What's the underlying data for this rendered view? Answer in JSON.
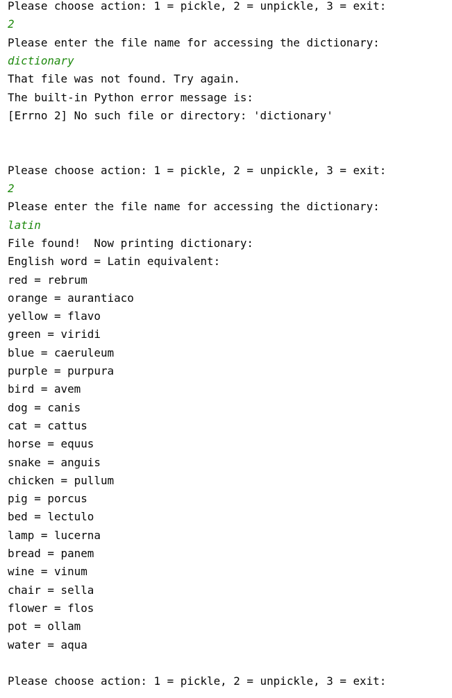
{
  "console": {
    "lines": [
      {
        "text": "Please choose action: 1 = pickle, 2 = unpickle, 3 = exit:",
        "kind": "output"
      },
      {
        "text": "2",
        "kind": "input"
      },
      {
        "text": "Please enter the file name for accessing the dictionary:",
        "kind": "output"
      },
      {
        "text": "dictionary",
        "kind": "input"
      },
      {
        "text": "That file was not found. Try again.",
        "kind": "output"
      },
      {
        "text": "The built-in Python error message is:",
        "kind": "output"
      },
      {
        "text": "[Errno 2] No such file or directory: 'dictionary'",
        "kind": "output"
      },
      {
        "text": "",
        "kind": "blank"
      },
      {
        "text": "",
        "kind": "blank"
      },
      {
        "text": "Please choose action: 1 = pickle, 2 = unpickle, 3 = exit:",
        "kind": "output"
      },
      {
        "text": "2",
        "kind": "input"
      },
      {
        "text": "Please enter the file name for accessing the dictionary:",
        "kind": "output"
      },
      {
        "text": "latin",
        "kind": "input"
      },
      {
        "text": "File found!  Now printing dictionary:",
        "kind": "output"
      },
      {
        "text": "English word = Latin equivalent:",
        "kind": "output"
      },
      {
        "text": "red = rebrum",
        "kind": "output"
      },
      {
        "text": "orange = aurantiaco",
        "kind": "output"
      },
      {
        "text": "yellow = flavo",
        "kind": "output"
      },
      {
        "text": "green = viridi",
        "kind": "output"
      },
      {
        "text": "blue = caeruleum",
        "kind": "output"
      },
      {
        "text": "purple = purpura",
        "kind": "output"
      },
      {
        "text": "bird = avem",
        "kind": "output"
      },
      {
        "text": "dog = canis",
        "kind": "output"
      },
      {
        "text": "cat = cattus",
        "kind": "output"
      },
      {
        "text": "horse = equus",
        "kind": "output"
      },
      {
        "text": "snake = anguis",
        "kind": "output"
      },
      {
        "text": "chicken = pullum",
        "kind": "output"
      },
      {
        "text": "pig = porcus",
        "kind": "output"
      },
      {
        "text": "bed = lectulo",
        "kind": "output"
      },
      {
        "text": "lamp = lucerna",
        "kind": "output"
      },
      {
        "text": "bread = panem",
        "kind": "output"
      },
      {
        "text": "wine = vinum",
        "kind": "output"
      },
      {
        "text": "chair = sella",
        "kind": "output"
      },
      {
        "text": "flower = flos",
        "kind": "output"
      },
      {
        "text": "pot = ollam",
        "kind": "output"
      },
      {
        "text": "water = aqua",
        "kind": "output"
      },
      {
        "text": "",
        "kind": "blank"
      },
      {
        "text": "Please choose action: 1 = pickle, 2 = unpickle, 3 = exit:",
        "kind": "output"
      }
    ]
  },
  "colors": {
    "output_text": "#080808",
    "user_input_text": "#1f8a0f",
    "background": "#ffffff"
  }
}
